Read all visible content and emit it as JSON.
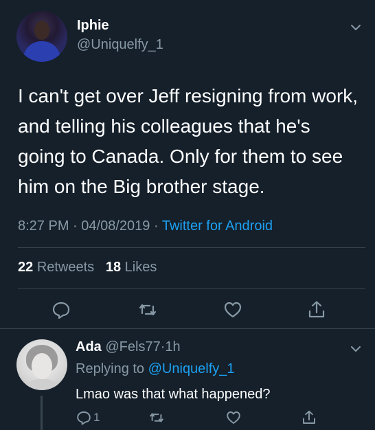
{
  "tweet": {
    "author_name": "Iphie",
    "author_handle": "@Uniquelfy_1",
    "text": "I can't get over Jeff resigning from work, and telling his colleagues that he's going to Canada. Only for them to see him on the Big brother stage.",
    "time": "8:27 PM",
    "separator": "·",
    "date": "04/08/2019",
    "source": "Twitter for Android",
    "retweets_count": "22",
    "retweets_label": "Retweets",
    "likes_count": "18",
    "likes_label": "Likes"
  },
  "reply": {
    "author_name": "Ada",
    "author_handle": "@Fels77",
    "separator": "·",
    "age": "1h",
    "replying_label": "Replying to",
    "replying_handle": "@Uniquelfy_1",
    "text": "Lmao was that what happened?",
    "reply_count": "1"
  },
  "colors": {
    "background": "#15202b",
    "accent": "#1da1f2",
    "muted": "#8899a6",
    "divider": "#38444d"
  },
  "icons": [
    "chevron-down-icon",
    "reply-icon",
    "retweet-icon",
    "like-icon",
    "share-icon"
  ]
}
